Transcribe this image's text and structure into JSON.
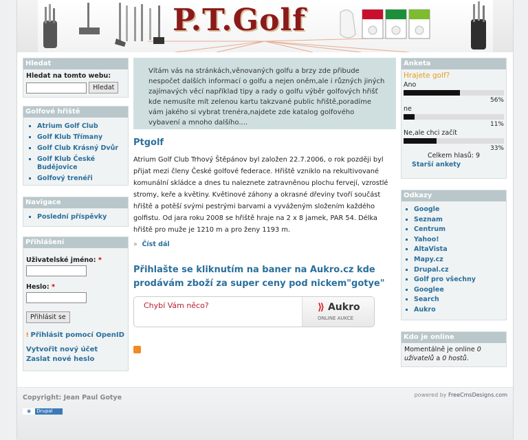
{
  "banner": {
    "title": "P.T.Golf"
  },
  "left": {
    "search": {
      "title": "Hledat",
      "label": "Hledat na tomto webu:",
      "button": "Hledat",
      "value": ""
    },
    "courses": {
      "title": "Golfové hřiště",
      "items": [
        "Atrium Golf Club",
        "Golf Klub Třímany",
        "Golf Club Krásný Dvůr",
        "Golf Klub České Budějovice",
        "Golfový trenéři"
      ]
    },
    "nav": {
      "title": "Navigace",
      "items": [
        "Poslední příspěvky"
      ]
    },
    "login": {
      "title": "Přihlášení",
      "user_label": "Uživatelské jméno:",
      "pass_label": "Heslo:",
      "required": "*",
      "button": "Přihlásit se",
      "openid": "Přihlásit pomocí OpenID",
      "create": "Vytvořit nový účet",
      "forgot": "Zaslat nové heslo"
    }
  },
  "center": {
    "welcome": "Vítám vás na stránkách,věnovaných golfu a brzy zde přibude nespočet dalších informací o golfu a nejen oněm,ale i různých jiných zajímavých věcí například tipy a rady o golfu výběr golfových hřišť kde nemusíte mít zelenou kartu takzvané public hřiště,poradíme vám jakého si vybrat trenéra,najdete zde katalog golfového vybavení a mnoho dalšího....",
    "node_title": "Ptgolf",
    "node_body": "Atrium Golf Club Trhový Štěpánov byl založen 22.7.2006, o rok později byl přijat mezi členy České golfové federace. Hřiště vzniklo na rekultivované komunální skládce a dnes tu naleznete zatravněnou plochu fervejí, vzrostlé stromy, keře a květiny. Květinové záhony a okrasné dřeviny tvoří součást hřiště a potěší svými pestrými barvami a vyváženým složením každého golfistu. Od jara roku 2008 se hřiště hraje na 2 x 8 jamek, PAR 54. Délka hřiště pro muže je 1210 m a pro ženy 1193 m.",
    "readmore": "Číst dál",
    "node2_title": "Přihlašte se kliknutím na baner na Aukro.cz kde prodávám zboží za super ceny pod nickem\"gotye\"",
    "aukro_question": "Chybí Vám něco?",
    "aukro_brand": "Aukro",
    "aukro_sub": "ONLINE AUKCE"
  },
  "right": {
    "poll": {
      "title": "Anketa",
      "question": "Hrajete golf?",
      "options": [
        {
          "label": "Ano",
          "percent": 56,
          "pct_text": "56%"
        },
        {
          "label": "ne",
          "percent": 11,
          "pct_text": "11%"
        },
        {
          "label": "Ne,ale chci začít",
          "percent": 33,
          "pct_text": "33%"
        }
      ],
      "total": "Celkem hlasů: 9",
      "older": "Starší ankety"
    },
    "links": {
      "title": "Odkazy",
      "items": [
        "Google",
        "Seznam",
        "Centrum",
        "Yahoo!",
        "AltaVista",
        "Mapy.cz",
        "Drupal.cz",
        "Golf pro všechny",
        "Googlee",
        "Search",
        "Aukro"
      ]
    },
    "online": {
      "title": "Kdo je online",
      "text_a": "Momentálně je online ",
      "users": "0 uživatelů",
      "text_b": " a ",
      "guests": "0 hostů",
      "text_c": "."
    }
  },
  "footer": {
    "copyright": "Copyright: Jean Paul Gotye",
    "powered": "powered by ",
    "powered_link": "FreeCmsDesigns.com",
    "drupal": "Drupal"
  },
  "colors": {
    "block_header": "#b9c7cb",
    "link": "#2a6f9b",
    "welcome_bg": "#cfdfe0"
  }
}
